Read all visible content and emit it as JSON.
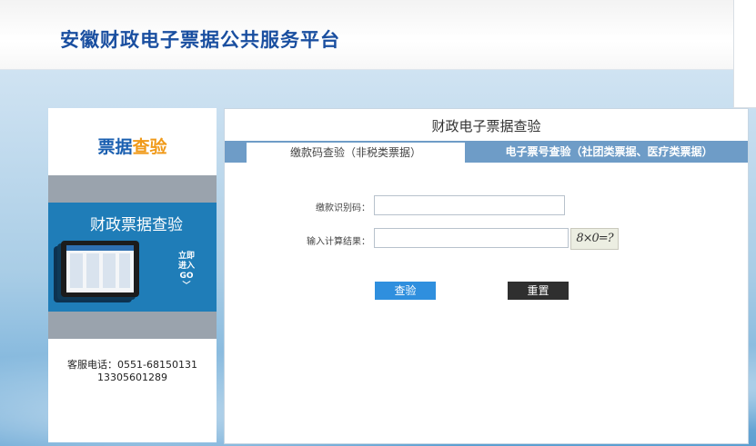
{
  "header": {
    "title": "安徽财政电子票据公共服务平台"
  },
  "left": {
    "title_part1": "票据",
    "title_part2": "查验",
    "promo_text": "财政票据查验",
    "go": {
      "line1": "立即",
      "line2": "进入",
      "line3": "GO",
      "arrow": "﹀"
    },
    "service_phone": "客服电话：0551-68150131",
    "service_mobile": "13305601289"
  },
  "main": {
    "title": "财政电子票据查验",
    "tabs": [
      {
        "label": "缴款码查验（非税类票据）"
      },
      {
        "label": "电子票号查验（社团类票据、医疗类票据）"
      }
    ],
    "form": {
      "code_label": "缴款识别码：",
      "code_value": "",
      "calc_label": "输入计算结果：",
      "calc_value": "",
      "captcha_text": "8×0=?"
    },
    "buttons": {
      "query": "查验",
      "reset": "重置"
    }
  },
  "colors": {
    "brand_blue": "#1a4fa0",
    "accent_orange": "#f09a1a",
    "tab_bar": "#6e9cc7",
    "query_button": "#2f8fde",
    "reset_button": "#2f2f2f"
  }
}
